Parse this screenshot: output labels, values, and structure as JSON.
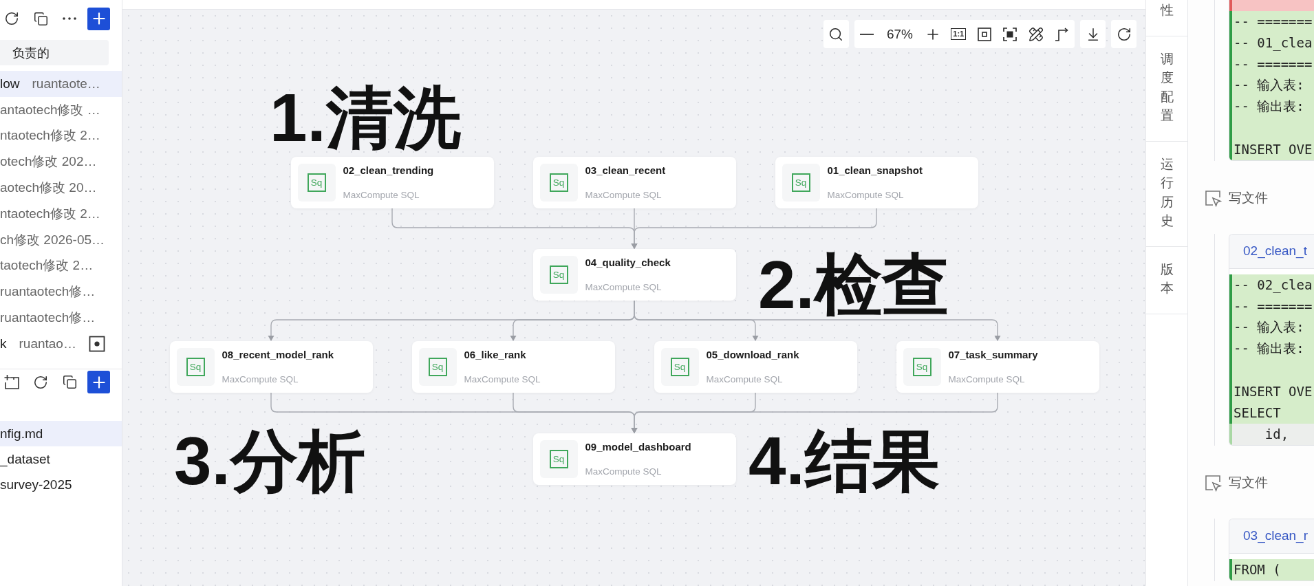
{
  "sidebar": {
    "filter": "负责的",
    "workflows": [
      {
        "kind": "plain",
        "name": "low",
        "meta": "ruantaote…",
        "selected": true
      },
      {
        "kind": "plain",
        "meta": "antaotech修改 …",
        "selected": false
      },
      {
        "kind": "plain",
        "meta": "ntaotech修改 2…",
        "selected": false
      },
      {
        "kind": "plain",
        "meta": "otech修改 202…",
        "selected": false
      },
      {
        "kind": "plain",
        "meta": "aotech修改 20…",
        "selected": false
      },
      {
        "kind": "plain",
        "meta": "ntaotech修改 2…",
        "selected": false
      },
      {
        "kind": "plain",
        "meta": "ch修改 2026-05…",
        "selected": false
      },
      {
        "kind": "plain",
        "meta": "taotech修改 2…",
        "selected": false
      },
      {
        "kind": "plain",
        "meta": "ruantaotech修…",
        "selected": false
      },
      {
        "kind": "plain",
        "meta": "ruantaotech修…",
        "selected": false
      },
      {
        "kind": "marked",
        "name": "k",
        "meta": "ruantao…",
        "selected": false
      }
    ],
    "files": [
      {
        "label": "nfig.md",
        "selected": true
      },
      {
        "label": "_dataset",
        "selected": false
      },
      {
        "label": "survey-2025",
        "selected": false
      }
    ]
  },
  "canvas": {
    "toolbar": {
      "zoom_level": "67%",
      "actual_size_label": "1:1"
    },
    "stages": [
      {
        "nodes": [
          {
            "name": "02_clean_trending",
            "type": "MaxCompute SQL",
            "icon_text": "Sq"
          },
          {
            "name": "03_clean_recent",
            "type": "MaxCompute SQL",
            "icon_text": "Sq"
          },
          {
            "name": "01_clean_snapshot",
            "type": "MaxCompute SQL",
            "icon_text": "Sq"
          }
        ]
      },
      {
        "nodes": [
          {
            "name": "04_quality_check",
            "type": "MaxCompute SQL",
            "icon_text": "Sq"
          }
        ]
      },
      {
        "nodes": [
          {
            "name": "08_recent_model_rank",
            "type": "MaxCompute SQL",
            "icon_text": "Sq"
          },
          {
            "name": "06_like_rank",
            "type": "MaxCompute SQL",
            "icon_text": "Sq"
          },
          {
            "name": "05_download_rank",
            "type": "MaxCompute SQL",
            "icon_text": "Sq"
          },
          {
            "name": "07_task_summary",
            "type": "MaxCompute SQL",
            "icon_text": "Sq"
          }
        ]
      },
      {
        "nodes": [
          {
            "name": "09_model_dashboard",
            "type": "MaxCompute SQL",
            "icon_text": "Sq"
          }
        ]
      }
    ],
    "annotations": [
      "1.清洗",
      "2.检查",
      "3.分析",
      "4.结果"
    ]
  },
  "side_tabs": [
    "性",
    "调度配置",
    "运行历史",
    "版本"
  ],
  "log": [
    {
      "kind": "diff",
      "rows": [
        {
          "kind": "removed"
        },
        {
          "kind": "added",
          "text": "-- ======="
        },
        {
          "kind": "added",
          "text": "-- 01_clea"
        },
        {
          "kind": "added",
          "text": "-- ======="
        },
        {
          "kind": "added",
          "text": "-- 输入表:"
        },
        {
          "kind": "added",
          "text": "-- 输出表:"
        },
        {
          "kind": "added"
        },
        {
          "kind": "added",
          "text": "INSERT OVE"
        }
      ]
    },
    {
      "kind": "action",
      "label": "写文件"
    },
    {
      "kind": "diff",
      "file": "02_clean_t",
      "rows": [
        {
          "kind": "added",
          "text": "-- 02_clea"
        },
        {
          "kind": "added",
          "text": "-- ======="
        },
        {
          "kind": "added",
          "text": "-- 输入表:"
        },
        {
          "kind": "added",
          "text": "-- 输出表:"
        },
        {
          "kind": "added"
        },
        {
          "kind": "added",
          "text": "INSERT OVE"
        },
        {
          "kind": "added",
          "text": "SELECT"
        },
        {
          "kind": "context",
          "text": "    id,"
        }
      ]
    },
    {
      "kind": "action",
      "label": "写文件"
    },
    {
      "kind": "diff",
      "file": "03_clean_r",
      "rows": [
        {
          "kind": "added",
          "text": "FROM ("
        }
      ]
    }
  ]
}
